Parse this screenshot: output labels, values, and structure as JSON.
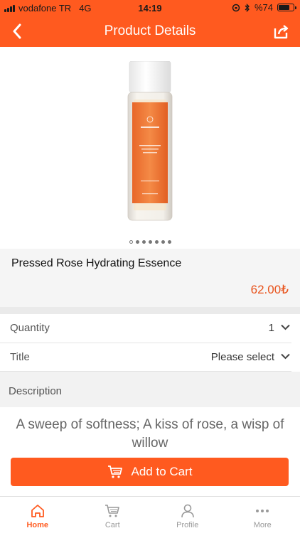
{
  "status_bar": {
    "carrier": "vodafone TR",
    "network": "4G",
    "time": "14:19",
    "battery_text": "%74",
    "battery_level": 0.74
  },
  "nav": {
    "title": "Product Details",
    "back_icon": "chevron-left-icon",
    "share_icon": "share-icon"
  },
  "gallery": {
    "image_count": 7,
    "active_index": 0
  },
  "product": {
    "name": "Pressed Rose Hydrating Essence",
    "price": "62.00₺"
  },
  "options": {
    "quantity_label": "Quantity",
    "quantity_value": "1",
    "title_label": "Title",
    "title_value": "Please select"
  },
  "description": {
    "heading": "Description",
    "text": "A sweep of softness; A kiss of rose, a wisp of willow"
  },
  "cart": {
    "button_label": "Add to Cart"
  },
  "tabs": [
    {
      "label": "Home",
      "icon": "home-icon",
      "active": true
    },
    {
      "label": "Cart",
      "icon": "cart-icon",
      "active": false
    },
    {
      "label": "Profile",
      "icon": "profile-icon",
      "active": false
    },
    {
      "label": "More",
      "icon": "more-icon",
      "active": false
    }
  ],
  "colors": {
    "accent": "#ff5a1f",
    "price": "#e8531c"
  }
}
